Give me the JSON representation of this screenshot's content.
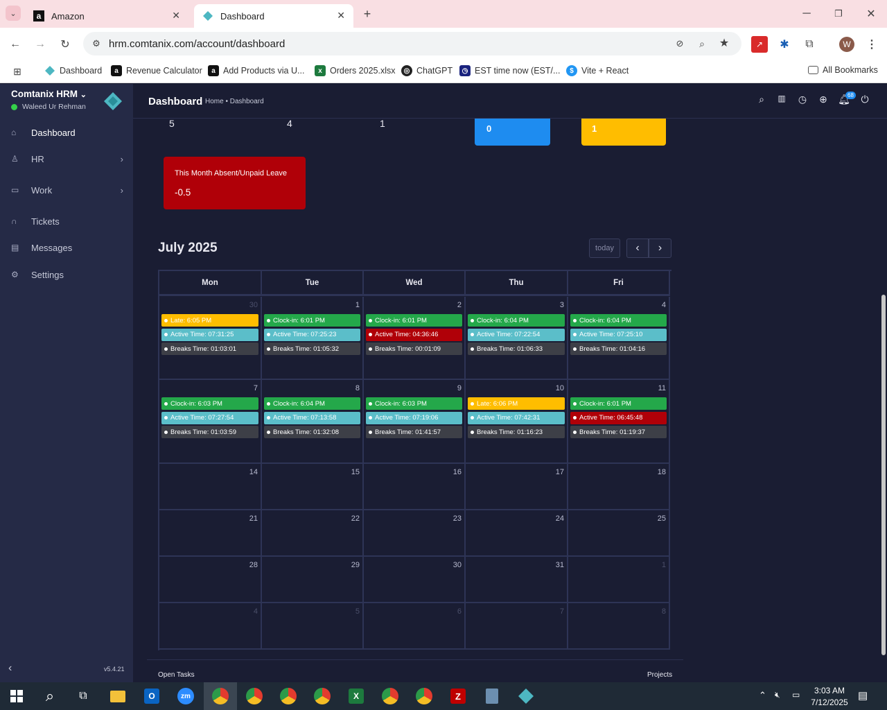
{
  "browser": {
    "tabs": [
      {
        "title": "Amazon",
        "icon": "amazon-icon",
        "active": false
      },
      {
        "title": "Dashboard",
        "icon": "comtanix-icon",
        "active": true
      }
    ],
    "url": "hrm.comtanix.com/account/dashboard",
    "profile_initial": "W",
    "bookmarks": [
      {
        "label": "Dashboard",
        "icon": "comtanix-icon"
      },
      {
        "label": "Revenue Calculator",
        "icon": "amazon-icon"
      },
      {
        "label": "Add Products via U...",
        "icon": "amazon-icon"
      },
      {
        "label": "Orders 2025.xlsx",
        "icon": "excel-icon"
      },
      {
        "label": "ChatGPT",
        "icon": "chatgpt-icon"
      },
      {
        "label": "EST time now (EST/...",
        "icon": "clock-icon"
      },
      {
        "label": "Vite + React",
        "icon": "vite-icon"
      }
    ],
    "all_bookmarks": "All Bookmarks"
  },
  "app": {
    "brand": "Comtanix HRM",
    "user": "Waleed Ur Rehman",
    "version": "v5.4.21",
    "nav": [
      {
        "label": "Dashboard",
        "icon": "home-icon",
        "active": true,
        "has_children": false
      },
      {
        "label": "HR",
        "icon": "users-icon",
        "active": false,
        "has_children": true
      },
      {
        "label": "Work",
        "icon": "briefcase-icon",
        "active": false,
        "has_children": true
      },
      {
        "label": "Tickets",
        "icon": "headset-icon",
        "active": false,
        "has_children": false
      },
      {
        "label": "Messages",
        "icon": "message-icon",
        "active": false,
        "has_children": false
      },
      {
        "label": "Settings",
        "icon": "gear-icon",
        "active": false,
        "has_children": false
      }
    ],
    "header": {
      "title": "Dashboard",
      "breadcrumb_home": "Home",
      "breadcrumb_current": "Dashboard",
      "notification_count": "68"
    }
  },
  "stats": {
    "values": [
      "5",
      "4",
      "1"
    ],
    "blue_card_value": "0",
    "yellow_card_value": "1",
    "absent_card": {
      "label": "This Month Absent/Unpaid Leave",
      "value": "-0.5"
    }
  },
  "calendar": {
    "title": "July 2025",
    "today_label": "today",
    "days": [
      "Mon",
      "Tue",
      "Wed",
      "Thu",
      "Fri"
    ],
    "weeks": [
      [
        {
          "day": "30",
          "other": true,
          "events": [
            {
              "text": "Late: 6:05 PM",
              "color": "yellow"
            },
            {
              "text": "Active Time: 07:31:25",
              "color": "teal"
            },
            {
              "text": "Breaks Time: 01:03:01",
              "color": "dark"
            }
          ]
        },
        {
          "day": "1",
          "other": false,
          "events": [
            {
              "text": "Clock-in: 6:01 PM",
              "color": "green"
            },
            {
              "text": "Active Time: 07:25:23",
              "color": "teal"
            },
            {
              "text": "Breaks Time: 01:05:32",
              "color": "dark"
            }
          ]
        },
        {
          "day": "2",
          "other": false,
          "events": [
            {
              "text": "Clock-in: 6:01 PM",
              "color": "green"
            },
            {
              "text": "Active Time: 04:36:46",
              "color": "red"
            },
            {
              "text": "Breaks Time: 00:01:09",
              "color": "dark"
            }
          ]
        },
        {
          "day": "3",
          "other": false,
          "events": [
            {
              "text": "Clock-in: 6:04 PM",
              "color": "green"
            },
            {
              "text": "Active Time: 07:22:54",
              "color": "teal"
            },
            {
              "text": "Breaks Time: 01:06:33",
              "color": "dark"
            }
          ]
        },
        {
          "day": "4",
          "other": false,
          "events": [
            {
              "text": "Clock-in: 6:04 PM",
              "color": "green"
            },
            {
              "text": "Active Time: 07:25:10",
              "color": "teal"
            },
            {
              "text": "Breaks Time: 01:04:16",
              "color": "dark"
            }
          ]
        }
      ],
      [
        {
          "day": "7",
          "other": false,
          "events": [
            {
              "text": "Clock-in: 6:03 PM",
              "color": "green"
            },
            {
              "text": "Active Time: 07:27:54",
              "color": "teal"
            },
            {
              "text": "Breaks Time: 01:03:59",
              "color": "dark"
            }
          ]
        },
        {
          "day": "8",
          "other": false,
          "events": [
            {
              "text": "Clock-in: 6:04 PM",
              "color": "green"
            },
            {
              "text": "Active Time: 07:13:58",
              "color": "teal"
            },
            {
              "text": "Breaks Time: 01:32:08",
              "color": "dark"
            }
          ]
        },
        {
          "day": "9",
          "other": false,
          "events": [
            {
              "text": "Clock-in: 6:03 PM",
              "color": "green"
            },
            {
              "text": "Active Time: 07:19:06",
              "color": "teal"
            },
            {
              "text": "Breaks Time: 01:41:57",
              "color": "dark"
            }
          ]
        },
        {
          "day": "10",
          "other": false,
          "events": [
            {
              "text": "Late: 6:06 PM",
              "color": "yellow"
            },
            {
              "text": "Active Time: 07:42:31",
              "color": "teal"
            },
            {
              "text": "Breaks Time: 01:16:23",
              "color": "dark"
            }
          ]
        },
        {
          "day": "11",
          "other": false,
          "events": [
            {
              "text": "Clock-in: 6:01 PM",
              "color": "green"
            },
            {
              "text": "Active Time: 06:45:48",
              "color": "red"
            },
            {
              "text": "Breaks Time: 01:19:37",
              "color": "dark"
            }
          ]
        }
      ],
      [
        {
          "day": "14",
          "other": false,
          "events": []
        },
        {
          "day": "15",
          "other": false,
          "events": []
        },
        {
          "day": "16",
          "other": false,
          "events": []
        },
        {
          "day": "17",
          "other": false,
          "events": []
        },
        {
          "day": "18",
          "other": false,
          "events": []
        }
      ],
      [
        {
          "day": "21",
          "other": false,
          "events": []
        },
        {
          "day": "22",
          "other": false,
          "events": []
        },
        {
          "day": "23",
          "other": false,
          "events": []
        },
        {
          "day": "24",
          "other": false,
          "events": []
        },
        {
          "day": "25",
          "other": false,
          "events": []
        }
      ],
      [
        {
          "day": "28",
          "other": false,
          "events": []
        },
        {
          "day": "29",
          "other": false,
          "events": []
        },
        {
          "day": "30",
          "other": false,
          "events": []
        },
        {
          "day": "31",
          "other": false,
          "events": []
        },
        {
          "day": "1",
          "other": true,
          "events": []
        }
      ],
      [
        {
          "day": "4",
          "other": true,
          "events": []
        },
        {
          "day": "5",
          "other": true,
          "events": []
        },
        {
          "day": "6",
          "other": true,
          "events": []
        },
        {
          "day": "7",
          "other": true,
          "events": []
        },
        {
          "day": "8",
          "other": true,
          "events": []
        }
      ]
    ]
  },
  "footer": {
    "left": "Open Tasks",
    "right": "Projects"
  },
  "taskbar": {
    "time": "3:03 AM",
    "date": "7/12/2025"
  },
  "colors": {
    "sidebar": "#252a46",
    "main": "#1a1d33",
    "accent_blue": "#1e8cf0",
    "accent_yellow": "#ffbd00",
    "accent_red": "#b00008",
    "green": "#24a84a",
    "teal": "#5bbec9"
  }
}
